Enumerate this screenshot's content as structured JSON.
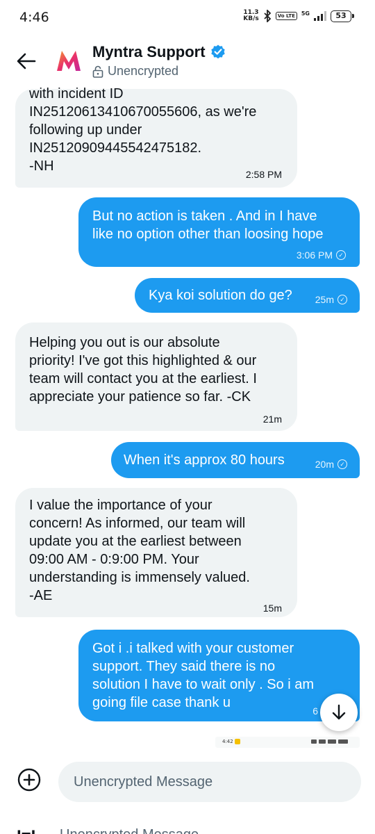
{
  "status_bar": {
    "time": "4:46",
    "speed_value": "11.3",
    "speed_unit": "KB/s",
    "volte": "Vo LTE",
    "network": "5G",
    "battery": "53"
  },
  "header": {
    "title": "Myntra Support",
    "subtitle": "Unencrypted",
    "verified": true,
    "brand_color": "#e9316a",
    "verified_color": "#1d9bf0"
  },
  "messages": [
    {
      "direction": "received",
      "text": "with incident ID\nIN25120613410670055606, as we're\nfollowing up under\nIN25120909445542475182.\n-NH",
      "time": "2:58 PM"
    },
    {
      "direction": "sent",
      "text": "But no action is taken . And  in I have\nlike no option other than loosing hope",
      "time": "3:06 PM"
    },
    {
      "direction": "sent",
      "text": "Kya koi solution do ge?",
      "time": "25m"
    },
    {
      "direction": "received",
      "text": "Helping you out is our absolute\npriority! I've got this highlighted & our\nteam will contact you at the earliest. I\nappreciate your patience so far. -CK",
      "time": "21m"
    },
    {
      "direction": "sent",
      "text": "When it's approx 80 hours",
      "time": "20m"
    },
    {
      "direction": "received",
      "text": "I value the importance of your\nconcern! As informed, our team will\nupdate you at the earliest  between\n09:00 AM - 0:9:00 PM. Your\nunderstanding is immensely valued.\n-AE",
      "time": "15m"
    },
    {
      "direction": "sent",
      "text": "Got i .i talked with your customer\nsupport. They said there is no\nsolution I have to wait only . So i  am\ngoing file case thank u",
      "time": "6"
    }
  ],
  "mini_strip": {
    "time": "4:42"
  },
  "composer": {
    "placeholder": "Unencrypted Message",
    "value": "",
    "cropped_placeholder": "Unencrypted Message"
  },
  "colors": {
    "sent_bubble": "#1d9bf0",
    "received_bubble": "#eff3f4",
    "accent": "#1d9bf0"
  },
  "icons": {
    "back": "arrow-left-icon",
    "lock": "lock-icon",
    "verified": "verified-badge-icon",
    "scroll_down": "arrow-down-icon",
    "add": "plus-circle-icon"
  }
}
